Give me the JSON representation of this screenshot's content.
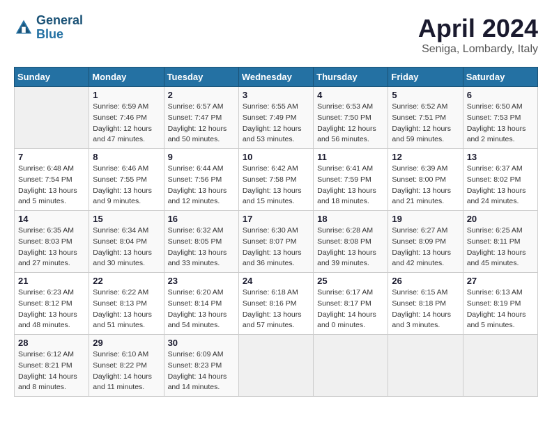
{
  "header": {
    "logo_line1": "General",
    "logo_line2": "Blue",
    "title": "April 2024",
    "subtitle": "Seniga, Lombardy, Italy"
  },
  "calendar": {
    "days_of_week": [
      "Sunday",
      "Monday",
      "Tuesday",
      "Wednesday",
      "Thursday",
      "Friday",
      "Saturday"
    ],
    "weeks": [
      [
        {
          "day": "",
          "info": ""
        },
        {
          "day": "1",
          "info": "Sunrise: 6:59 AM\nSunset: 7:46 PM\nDaylight: 12 hours\nand 47 minutes."
        },
        {
          "day": "2",
          "info": "Sunrise: 6:57 AM\nSunset: 7:47 PM\nDaylight: 12 hours\nand 50 minutes."
        },
        {
          "day": "3",
          "info": "Sunrise: 6:55 AM\nSunset: 7:49 PM\nDaylight: 12 hours\nand 53 minutes."
        },
        {
          "day": "4",
          "info": "Sunrise: 6:53 AM\nSunset: 7:50 PM\nDaylight: 12 hours\nand 56 minutes."
        },
        {
          "day": "5",
          "info": "Sunrise: 6:52 AM\nSunset: 7:51 PM\nDaylight: 12 hours\nand 59 minutes."
        },
        {
          "day": "6",
          "info": "Sunrise: 6:50 AM\nSunset: 7:53 PM\nDaylight: 13 hours\nand 2 minutes."
        }
      ],
      [
        {
          "day": "7",
          "info": "Sunrise: 6:48 AM\nSunset: 7:54 PM\nDaylight: 13 hours\nand 5 minutes."
        },
        {
          "day": "8",
          "info": "Sunrise: 6:46 AM\nSunset: 7:55 PM\nDaylight: 13 hours\nand 9 minutes."
        },
        {
          "day": "9",
          "info": "Sunrise: 6:44 AM\nSunset: 7:56 PM\nDaylight: 13 hours\nand 12 minutes."
        },
        {
          "day": "10",
          "info": "Sunrise: 6:42 AM\nSunset: 7:58 PM\nDaylight: 13 hours\nand 15 minutes."
        },
        {
          "day": "11",
          "info": "Sunrise: 6:41 AM\nSunset: 7:59 PM\nDaylight: 13 hours\nand 18 minutes."
        },
        {
          "day": "12",
          "info": "Sunrise: 6:39 AM\nSunset: 8:00 PM\nDaylight: 13 hours\nand 21 minutes."
        },
        {
          "day": "13",
          "info": "Sunrise: 6:37 AM\nSunset: 8:02 PM\nDaylight: 13 hours\nand 24 minutes."
        }
      ],
      [
        {
          "day": "14",
          "info": "Sunrise: 6:35 AM\nSunset: 8:03 PM\nDaylight: 13 hours\nand 27 minutes."
        },
        {
          "day": "15",
          "info": "Sunrise: 6:34 AM\nSunset: 8:04 PM\nDaylight: 13 hours\nand 30 minutes."
        },
        {
          "day": "16",
          "info": "Sunrise: 6:32 AM\nSunset: 8:05 PM\nDaylight: 13 hours\nand 33 minutes."
        },
        {
          "day": "17",
          "info": "Sunrise: 6:30 AM\nSunset: 8:07 PM\nDaylight: 13 hours\nand 36 minutes."
        },
        {
          "day": "18",
          "info": "Sunrise: 6:28 AM\nSunset: 8:08 PM\nDaylight: 13 hours\nand 39 minutes."
        },
        {
          "day": "19",
          "info": "Sunrise: 6:27 AM\nSunset: 8:09 PM\nDaylight: 13 hours\nand 42 minutes."
        },
        {
          "day": "20",
          "info": "Sunrise: 6:25 AM\nSunset: 8:11 PM\nDaylight: 13 hours\nand 45 minutes."
        }
      ],
      [
        {
          "day": "21",
          "info": "Sunrise: 6:23 AM\nSunset: 8:12 PM\nDaylight: 13 hours\nand 48 minutes."
        },
        {
          "day": "22",
          "info": "Sunrise: 6:22 AM\nSunset: 8:13 PM\nDaylight: 13 hours\nand 51 minutes."
        },
        {
          "day": "23",
          "info": "Sunrise: 6:20 AM\nSunset: 8:14 PM\nDaylight: 13 hours\nand 54 minutes."
        },
        {
          "day": "24",
          "info": "Sunrise: 6:18 AM\nSunset: 8:16 PM\nDaylight: 13 hours\nand 57 minutes."
        },
        {
          "day": "25",
          "info": "Sunrise: 6:17 AM\nSunset: 8:17 PM\nDaylight: 14 hours\nand 0 minutes."
        },
        {
          "day": "26",
          "info": "Sunrise: 6:15 AM\nSunset: 8:18 PM\nDaylight: 14 hours\nand 3 minutes."
        },
        {
          "day": "27",
          "info": "Sunrise: 6:13 AM\nSunset: 8:19 PM\nDaylight: 14 hours\nand 5 minutes."
        }
      ],
      [
        {
          "day": "28",
          "info": "Sunrise: 6:12 AM\nSunset: 8:21 PM\nDaylight: 14 hours\nand 8 minutes."
        },
        {
          "day": "29",
          "info": "Sunrise: 6:10 AM\nSunset: 8:22 PM\nDaylight: 14 hours\nand 11 minutes."
        },
        {
          "day": "30",
          "info": "Sunrise: 6:09 AM\nSunset: 8:23 PM\nDaylight: 14 hours\nand 14 minutes."
        },
        {
          "day": "",
          "info": ""
        },
        {
          "day": "",
          "info": ""
        },
        {
          "day": "",
          "info": ""
        },
        {
          "day": "",
          "info": ""
        }
      ]
    ]
  }
}
